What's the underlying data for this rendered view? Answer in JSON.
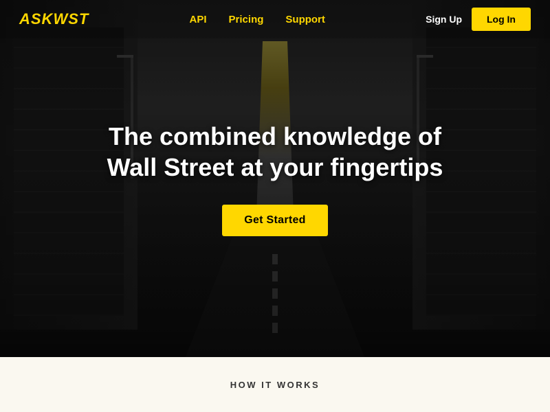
{
  "navbar": {
    "logo": "AskWST",
    "links": [
      {
        "id": "api",
        "label": "API"
      },
      {
        "id": "pricing",
        "label": "Pricing"
      },
      {
        "id": "support",
        "label": "Support"
      }
    ],
    "signup_label": "Sign Up",
    "login_label": "Log In"
  },
  "hero": {
    "title_line1": "The combined knowledge of",
    "title_line2": "Wall Street at your fingertips",
    "cta_label": "Get Started"
  },
  "how_it_works": {
    "section_label": "HOW IT WORKS"
  },
  "colors": {
    "accent": "#FFD700",
    "background_dark": "#1a1a1a",
    "background_light": "#FAF8F0"
  }
}
